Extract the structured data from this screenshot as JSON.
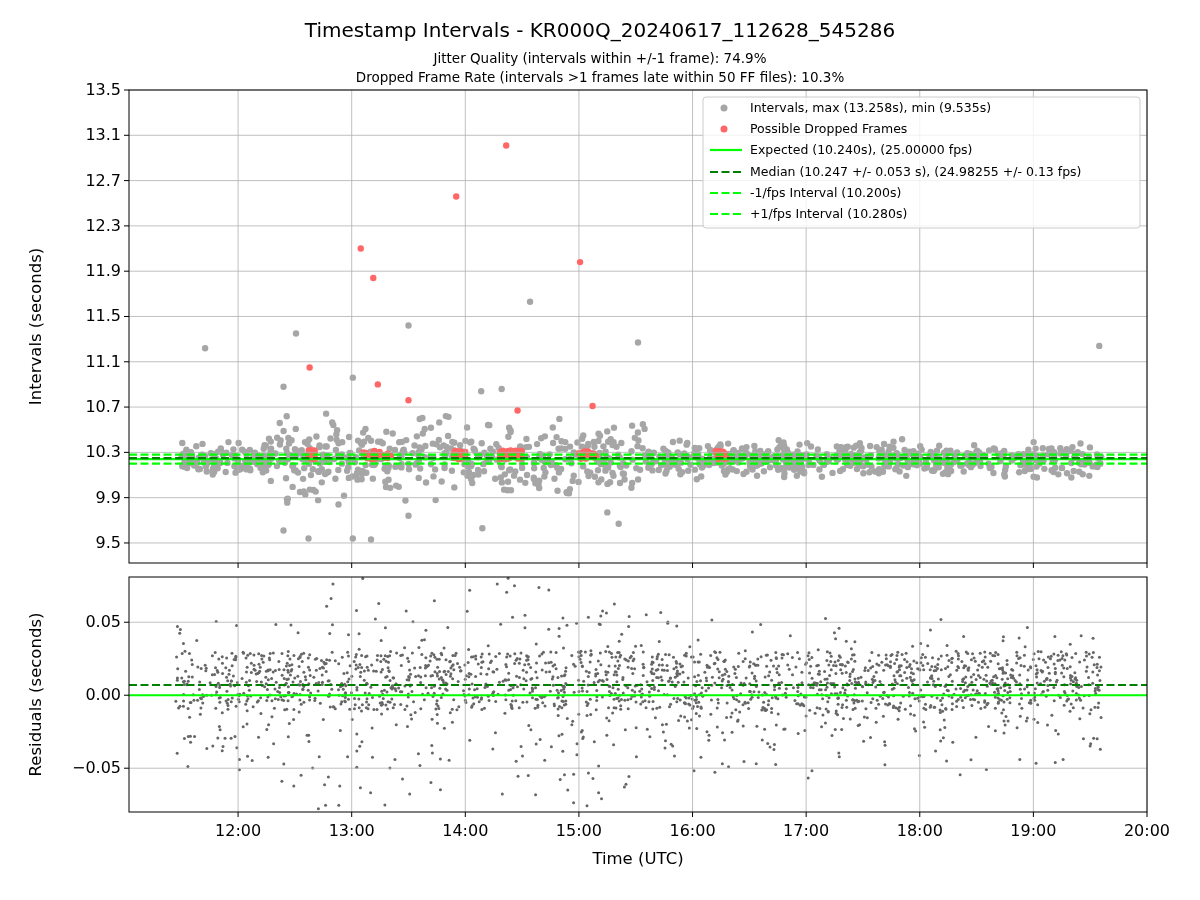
{
  "title": "Timestamp Intervals - KR000Q_20240617_112628_545286",
  "subtitles": [
    "Jitter Quality (intervals within +/-1 frame): 74.9%",
    "Dropped Frame Rate (intervals >1 frames late within 50 FF files): 10.3%"
  ],
  "charts": [
    {
      "chart_data": {
        "type": "scatter",
        "ylabel": "Intervals (seconds)",
        "grid": true,
        "legend": "upper right",
        "xlim": [
          11.04,
          20
        ],
        "ylim": [
          9.323,
          13.5
        ],
        "yticks": [
          {
            "value": 13.5,
            "label": "13.5"
          },
          {
            "value": 13.1,
            "label": "13.1"
          },
          {
            "value": 12.7,
            "label": "12.7"
          },
          {
            "value": 12.3,
            "label": "12.3"
          },
          {
            "value": 11.9,
            "label": "11.9"
          },
          {
            "value": 11.5,
            "label": "11.5"
          },
          {
            "value": 11.1,
            "label": "11.1"
          },
          {
            "value": 10.7,
            "label": "10.7"
          },
          {
            "value": 10.3,
            "label": "10.3"
          },
          {
            "value": 9.9,
            "label": "9.9"
          },
          {
            "value": 9.5,
            "label": "9.5"
          }
        ],
        "series": [
          {
            "name": "Intervals, max (13.258s), min (9.535s)",
            "color": "#a6a6a6",
            "x": [
              11.71,
              12.51,
              12.4,
              12.4,
              12.62,
              13.01,
              13.01,
              13.17,
              13.5,
              13.5,
              14.57,
              15.52,
              19.58,
              14.15,
              14.32,
              14.14,
              15.35,
              15.25
            ],
            "values": [
              11.22,
              11.35,
              10.88,
              9.61,
              9.54,
              10.96,
              9.54,
              9.53,
              11.42,
              9.74,
              11.63,
              11.27,
              11.24,
              9.63,
              10.86,
              10.84,
              9.67,
              9.77
            ]
          },
          {
            "name": "Possible Dropped Frames",
            "color": "#ff6666",
            "x": [
              13.08,
              13.19,
              13.23,
              13.5,
              13.92,
              14.36,
              15.01,
              15.12,
              14.46,
              12.63
            ],
            "values": [
              12.1,
              11.84,
              10.9,
              10.76,
              12.56,
              13.01,
              11.98,
              10.71,
              10.67,
              11.05
            ]
          },
          {
            "name": "Expected (10.240s), (25.00000 fps)",
            "type": "line",
            "line_style": "solid",
            "color": "#00ff00",
            "x": [
              11.04,
              20
            ],
            "values": [
              10.24,
              10.24
            ]
          },
          {
            "name": "Median (10.247 +/- 0.053 s), (24.98255 +/- 0.13 fps)",
            "type": "line",
            "line_style": "dashed",
            "color": "#008000",
            "x": [
              11.04,
              20
            ],
            "values": [
              10.25,
              10.25
            ]
          },
          {
            "name": "-1/fps Interval (10.200s)",
            "type": "line",
            "line_style": "dashed",
            "color": "#00ff00",
            "x": [
              11.04,
              20
            ],
            "values": [
              10.2,
              10.2
            ]
          },
          {
            "name": "+1/fps Interval (10.280s)",
            "type": "line",
            "line_style": "dashed",
            "color": "#00ff00",
            "x": [
              11.04,
              20
            ],
            "values": [
              10.28,
              10.28
            ]
          }
        ]
      }
    },
    {
      "chart_data": {
        "type": "scatter",
        "xlabel": "Time (UTC)",
        "ylabel": "Residuals (seconds)",
        "grid": true,
        "xlim": [
          11.04,
          20
        ],
        "ylim": [
          -0.08,
          0.081
        ],
        "xticks": [
          {
            "value": 12,
            "label": "12:00"
          },
          {
            "value": 13,
            "label": "13:00"
          },
          {
            "value": 14,
            "label": "14:00"
          },
          {
            "value": 15,
            "label": "15:00"
          },
          {
            "value": 16,
            "label": "16:00"
          },
          {
            "value": 17,
            "label": "17:00"
          },
          {
            "value": 18,
            "label": "18:00"
          },
          {
            "value": 19,
            "label": "19:00"
          },
          {
            "value": 20,
            "label": "20:00"
          }
        ],
        "yticks": [
          {
            "value": 0.05,
            "label": "0.05"
          },
          {
            "value": 0,
            "label": "0.00"
          },
          {
            "value": -0.05,
            "label": "−0.05"
          }
        ],
        "series": [
          {
            "type": "line",
            "line_style": "solid",
            "color": "#00ff00",
            "x": [
              11.04,
              20
            ],
            "values": [
              0,
              0
            ]
          },
          {
            "type": "line",
            "line_style": "dashed",
            "color": "#008000",
            "x": [
              11.04,
              20
            ],
            "values": [
              0.007,
              0.007
            ]
          }
        ]
      }
    }
  ]
}
